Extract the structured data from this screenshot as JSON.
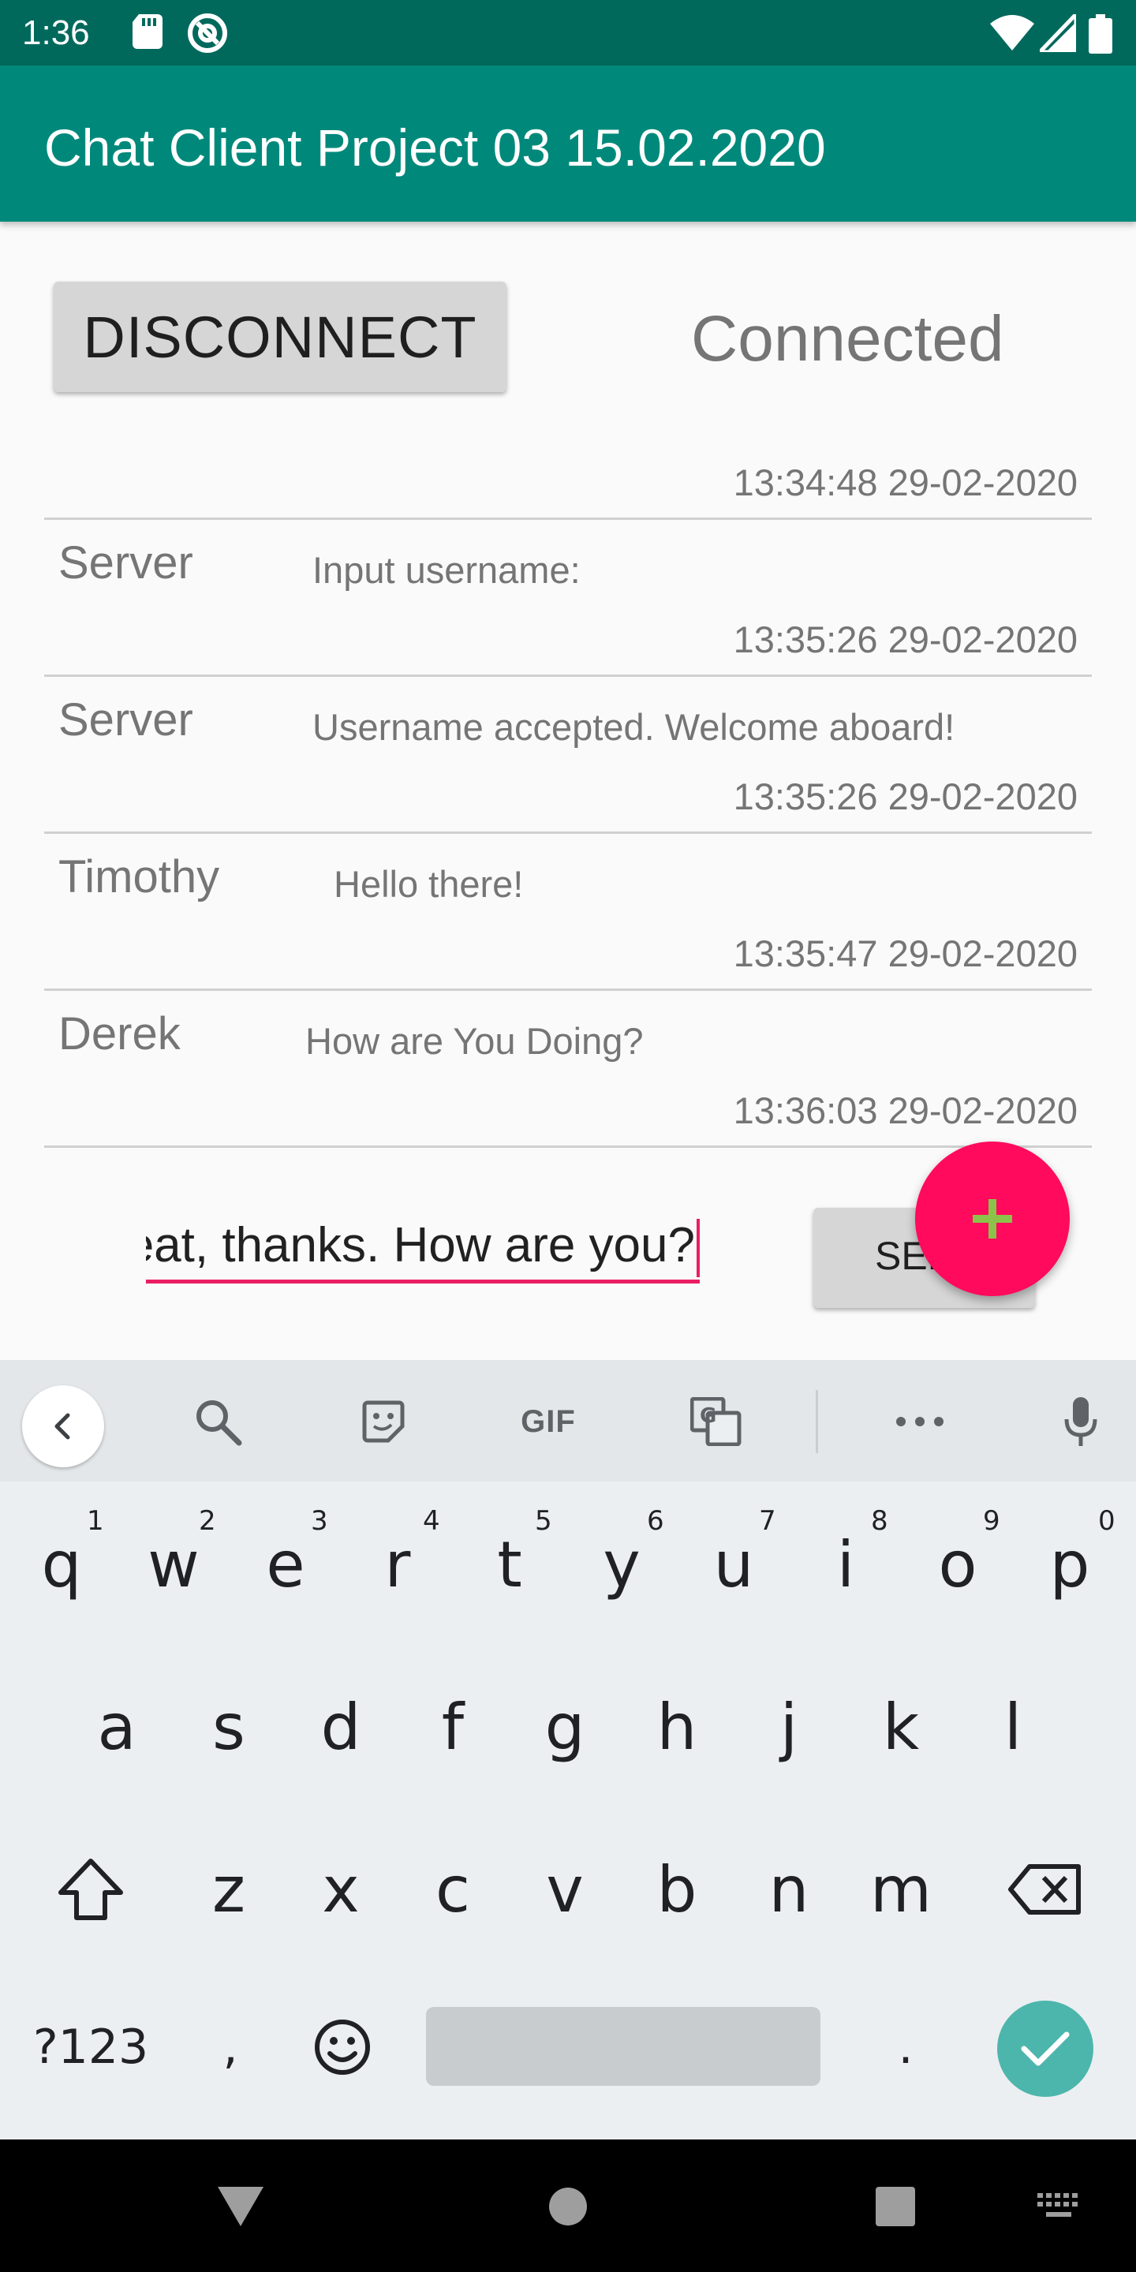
{
  "status_bar": {
    "time": "1:36",
    "icons": [
      "sd-card-icon",
      "at-sign-icon",
      "wifi-icon",
      "signal-icon",
      "battery-icon"
    ]
  },
  "app_bar": {
    "title": "Chat Client Project 03 15.02.2020"
  },
  "controls": {
    "disconnect_label": "DISCONNECT",
    "status": "Connected"
  },
  "messages": [
    {
      "sender": "",
      "text": "",
      "time": "13:34:48 29-02-2020"
    },
    {
      "sender": "Server",
      "text": "Input username:",
      "time": "13:35:26 29-02-2020"
    },
    {
      "sender": "Server",
      "text": "Username accepted. Welcome aboard!",
      "time": "13:35:26 29-02-2020"
    },
    {
      "sender": "Timothy",
      "text": "Hello there!",
      "time": "13:35:47 29-02-2020"
    },
    {
      "sender": "Derek",
      "text": "How are You Doing?",
      "time": "13:36:03 29-02-2020"
    }
  ],
  "composer": {
    "value": "eat, thanks. How are you?",
    "send_label": "SEND"
  },
  "fab": {
    "icon": "plus-icon"
  },
  "keyboard": {
    "toolbar": {
      "gif_label": "GIF"
    },
    "row1": [
      "q",
      "w",
      "e",
      "r",
      "t",
      "y",
      "u",
      "i",
      "o",
      "p"
    ],
    "row1_hints": [
      "1",
      "2",
      "3",
      "4",
      "5",
      "6",
      "7",
      "8",
      "9",
      "0"
    ],
    "row2": [
      "a",
      "s",
      "d",
      "f",
      "g",
      "h",
      "j",
      "k",
      "l"
    ],
    "row3": [
      "z",
      "x",
      "c",
      "v",
      "b",
      "n",
      "m"
    ],
    "symbols_label": "?123",
    "comma": ",",
    "period": "."
  },
  "colors": {
    "status_bar": "#00695c",
    "app_bar": "#00897b",
    "accent": "#e91e63",
    "fab": "#ff0a5c",
    "enter_key": "#4db6ac"
  }
}
